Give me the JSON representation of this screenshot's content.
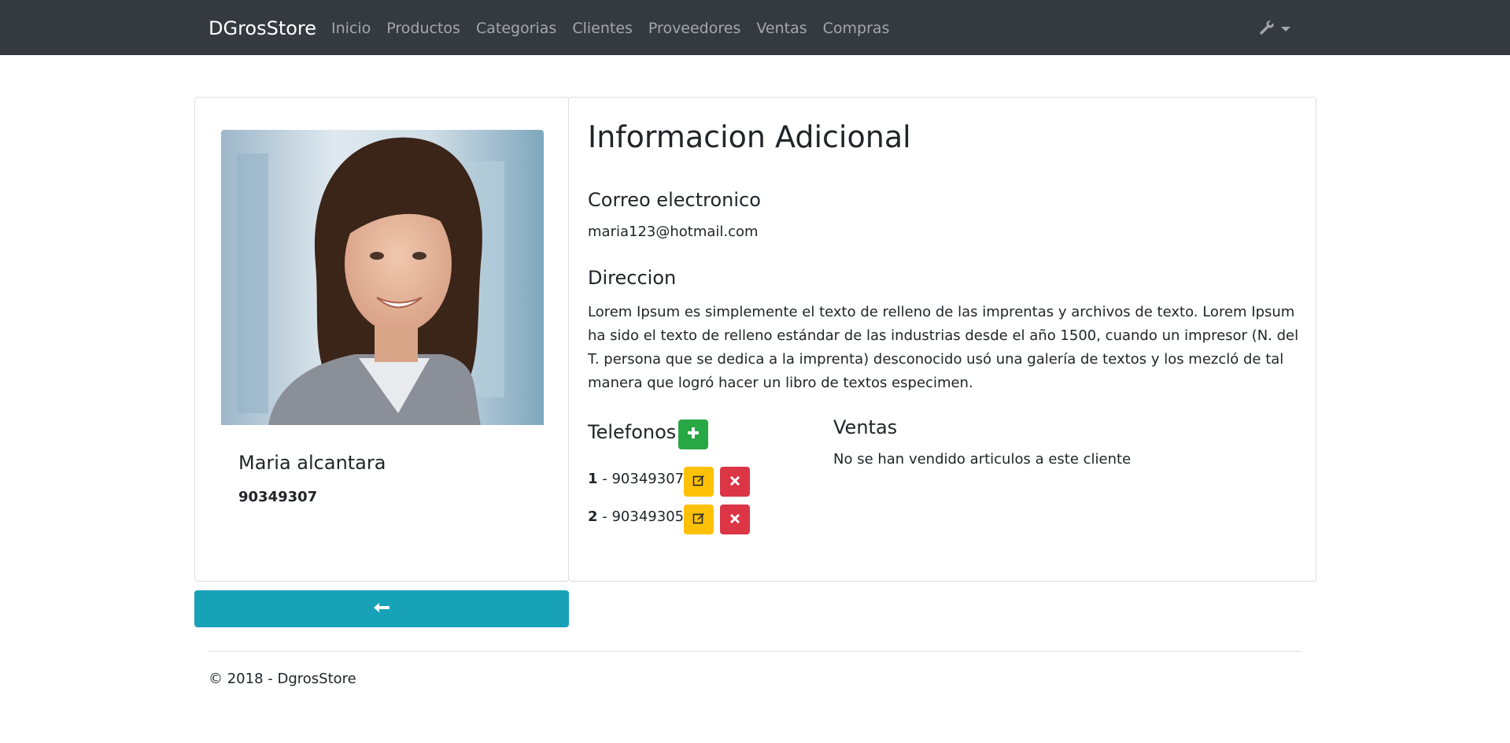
{
  "navbar": {
    "brand": "DGrosStore",
    "links": [
      "Inicio",
      "Productos",
      "Categorias",
      "Clientes",
      "Proveedores",
      "Ventas",
      "Compras"
    ],
    "tools_icon": "wrench-icon"
  },
  "client": {
    "name": "Maria alcantara",
    "phone": "90349307"
  },
  "info": {
    "title": "Informacion Adicional",
    "email_heading": "Correo electronico",
    "email": "maria123@hotmail.com",
    "address_heading": "Direccion",
    "address": "Lorem Ipsum es simplemente el texto de relleno de las imprentas y archivos de texto. Lorem Ipsum ha sido el texto de relleno estándar de las industrias desde el año 1500, cuando un impresor (N. del T. persona que se dedica a la imprenta) desconocido usó una galería de textos y los mezcló de tal manera que logró hacer un libro de textos especimen."
  },
  "phones": {
    "heading": "Telefonos",
    "items": [
      {
        "index": "1",
        "separator": " - ",
        "number": "90349307"
      },
      {
        "index": "2",
        "separator": " - ",
        "number": "90349305"
      }
    ]
  },
  "sales": {
    "heading": "Ventas",
    "empty_text": "No se han vendido articulos a este cliente"
  },
  "footer": {
    "text": "© 2018 - DgrosStore"
  },
  "colors": {
    "navbar": "#343a40",
    "add": "#28a745",
    "edit": "#ffc107",
    "delete": "#dc3545",
    "back": "#17a2b8"
  }
}
